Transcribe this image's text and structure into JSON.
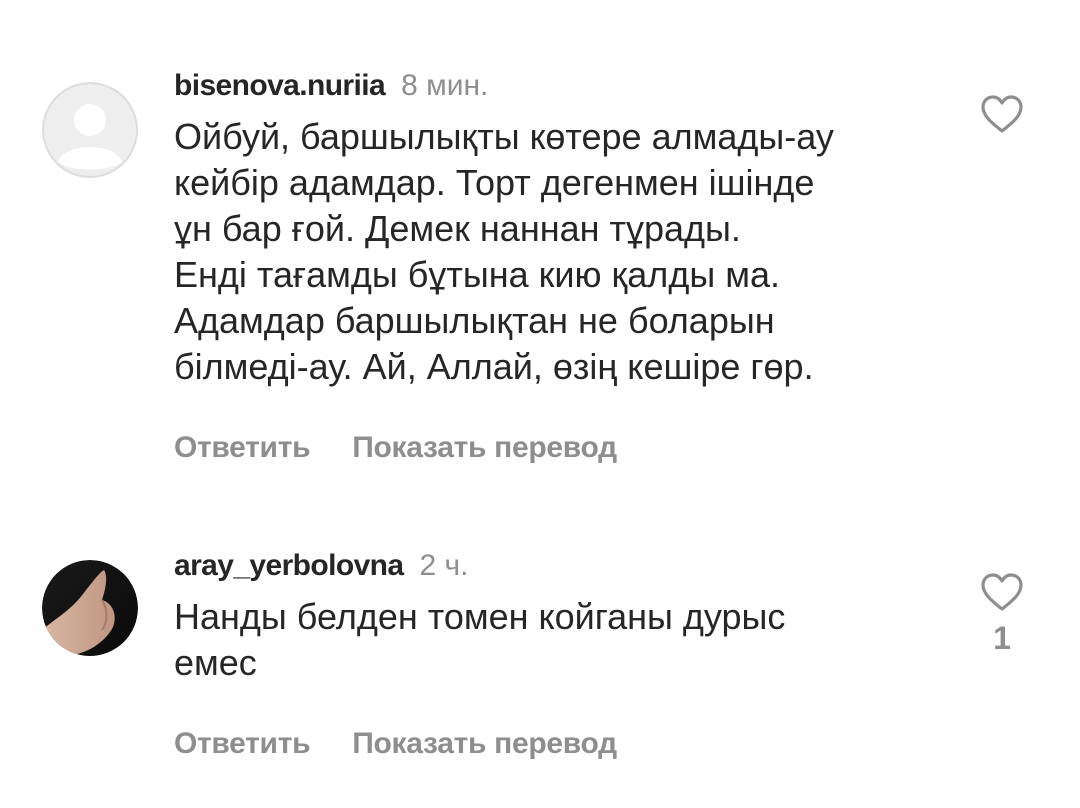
{
  "comments": [
    {
      "username": "bisenova.nuriia",
      "time": "8 мин.",
      "text": "Ойбуй, баршылықты көтере алмады-ау\nкейбір адамдар.  Торт дегенмен ішінде\nұн бар ғой. Демек наннан тұрады.\nЕнді тағамды бұтына кию қалды ма.\nАдамдар баршылықтан не боларын\nбілмеді-ау.  Ай, Аллай, өзің кешіре гөр.",
      "reply_label": "Ответить",
      "translate_label": "Показать перевод",
      "like_count": "",
      "avatar": "default-avatar-icon"
    },
    {
      "username": "aray_yerbolovna",
      "time": "2 ч.",
      "text": "Нанды белден томен койганы дурыс\nемес",
      "reply_label": "Ответить",
      "translate_label": "Показать перевод",
      "like_count": "1",
      "avatar": "user-photo"
    }
  ],
  "colors": {
    "text": "#262626",
    "secondary": "#8e8e8e",
    "background": "#ffffff"
  }
}
